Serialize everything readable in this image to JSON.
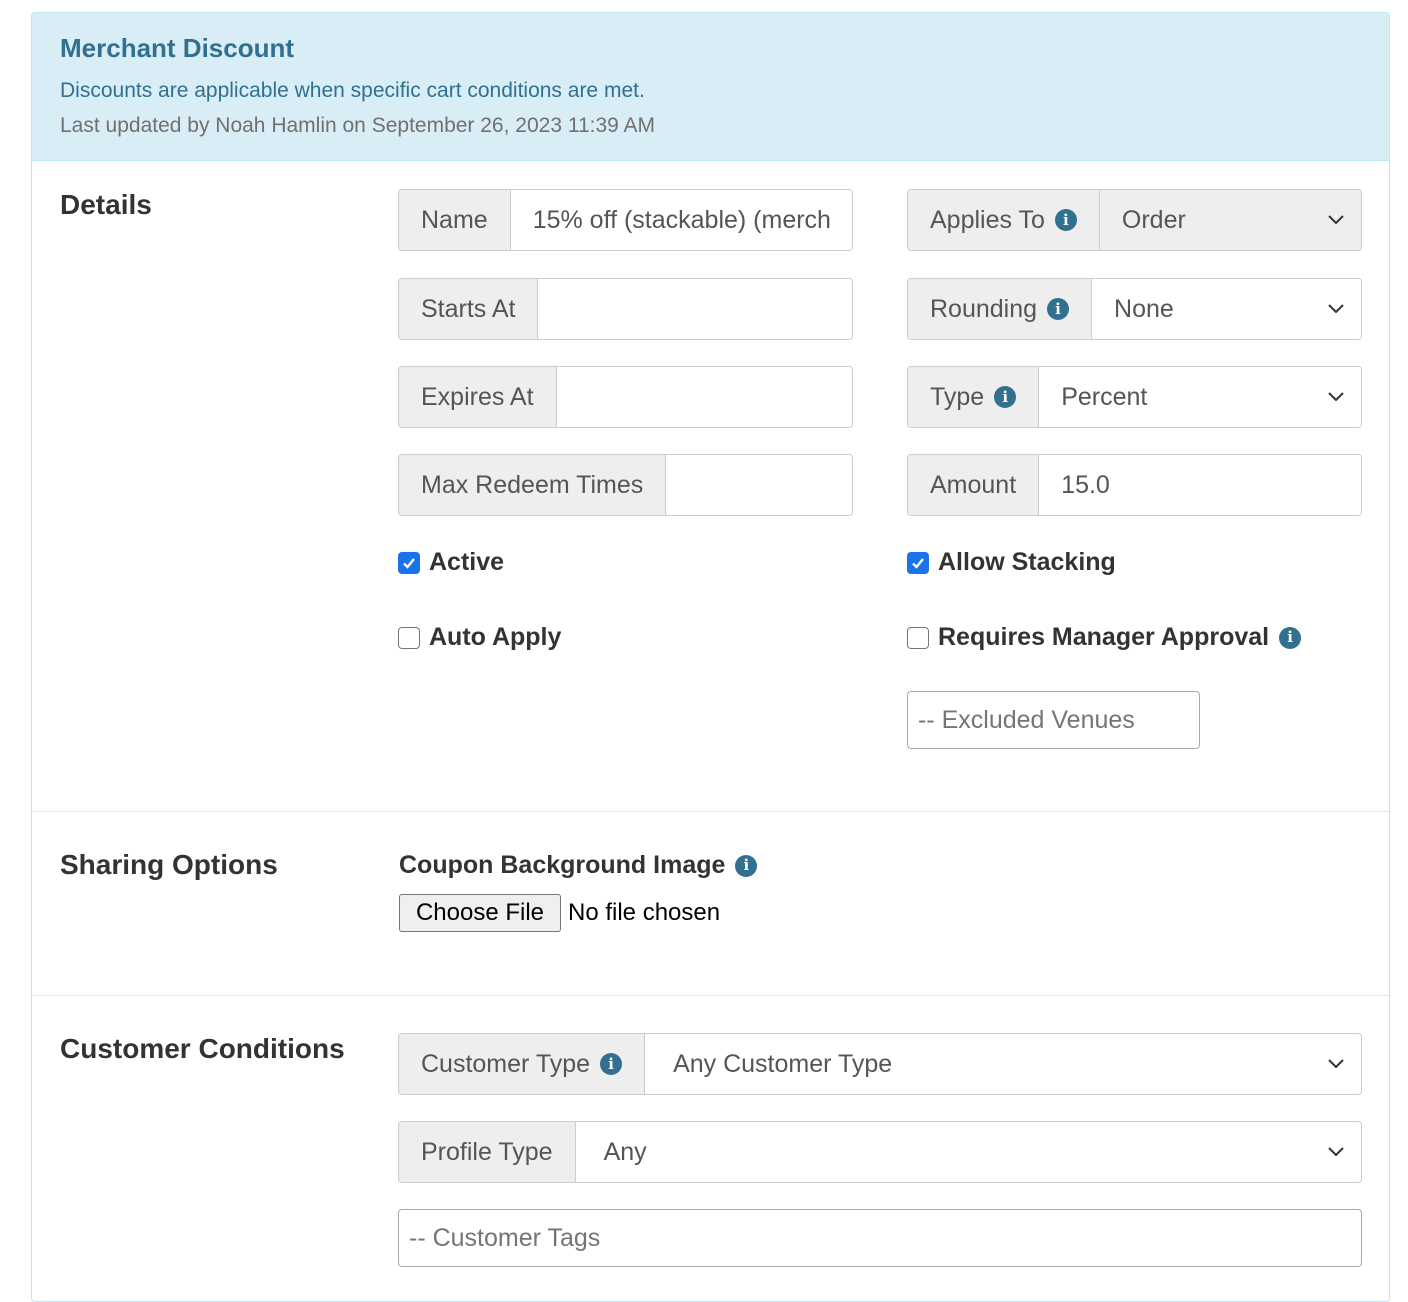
{
  "header": {
    "title": "Merchant Discount",
    "subtitle": "Discounts are applicable when specific cart conditions are met.",
    "updated": "Last updated by Noah Hamlin on September 26, 2023 11:39 AM"
  },
  "details": {
    "section_title": "Details",
    "name": {
      "label": "Name",
      "value": "15% off (stackable) (merch"
    },
    "starts_at": {
      "label": "Starts At",
      "value": ""
    },
    "expires_at": {
      "label": "Expires At",
      "value": ""
    },
    "max_redeem": {
      "label": "Max Redeem Times",
      "value": ""
    },
    "applies_to": {
      "label": "Applies To",
      "value": "Order"
    },
    "rounding": {
      "label": "Rounding",
      "value": "None"
    },
    "type": {
      "label": "Type",
      "value": "Percent"
    },
    "amount": {
      "label": "Amount",
      "value": "15.0"
    },
    "active": {
      "label": "Active",
      "checked": true
    },
    "auto_apply": {
      "label": "Auto Apply",
      "checked": false
    },
    "allow_stacking": {
      "label": "Allow Stacking",
      "checked": true
    },
    "requires_manager_approval": {
      "label": "Requires Manager Approval",
      "checked": false
    },
    "excluded_venues_placeholder": "-- Excluded Venues"
  },
  "sharing": {
    "section_title": "Sharing Options",
    "coupon_bg_label": "Coupon Background Image",
    "choose_file": "Choose File",
    "no_file": "No file chosen"
  },
  "customer": {
    "section_title": "Customer Conditions",
    "customer_type": {
      "label": "Customer Type",
      "value": "Any Customer Type"
    },
    "profile_type": {
      "label": "Profile Type",
      "value": "Any"
    },
    "customer_tags_placeholder": "-- Customer Tags"
  },
  "icons": {
    "info": "info-circle-icon",
    "chevron": "chevron-down-icon",
    "check": "checkmark-icon"
  },
  "colors": {
    "heading_bg": "#d9edf7",
    "heading_text": "#31708f",
    "checkbox_on": "#1a73e8"
  }
}
